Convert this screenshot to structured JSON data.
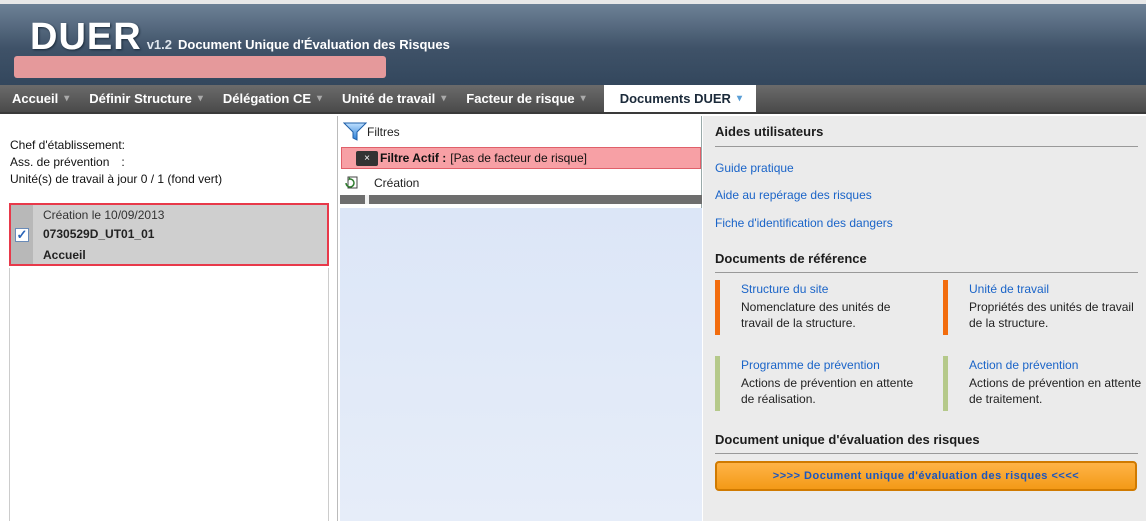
{
  "header": {
    "logo": "DUER",
    "version": "v1.2",
    "subtitle": "Document Unique d'Évaluation des Risques"
  },
  "nav": {
    "items": [
      {
        "label": "Accueil"
      },
      {
        "label": "Définir Structure"
      },
      {
        "label": "Délégation CE"
      },
      {
        "label": "Unité de travail"
      },
      {
        "label": "Facteur de risque"
      },
      {
        "label": "Documents DUER"
      }
    ],
    "caret": "▾"
  },
  "left": {
    "chef_label": "Chef d'établissement:",
    "ass_label": "Ass. de prévention",
    "ass_sep": ":",
    "units_status": "Unité(s) de travail à jour 0 / 1 (fond vert)",
    "card": {
      "created": "Création le 10/09/2013",
      "code": "0730529D_UT01_01",
      "name": "Accueil",
      "checked": true
    }
  },
  "middle": {
    "filters_label": "Filtres",
    "filter_active_label": "Filtre Actif :",
    "filter_active_value": "[Pas de facteur de risque]",
    "close_glyph": "×",
    "creation_label": "Création"
  },
  "right": {
    "aides_title": "Aides utilisateurs",
    "aides_links": [
      "Guide pratique",
      "Aide au repérage des risques",
      "Fiche d'identification des dangers"
    ],
    "refs_title": "Documents de référence",
    "refs": [
      {
        "title": "Structure du site",
        "desc": "Nomenclature des unités de travail de la structure.",
        "color": "#f26c0d"
      },
      {
        "title": "Unité de travail",
        "desc": "Propriétés des unités de travail de la structure.",
        "color": "#f26c0d"
      },
      {
        "title": "Programme de prévention",
        "desc": "Actions de prévention en attente de réalisation.",
        "color": "#b5c98a"
      },
      {
        "title": "Action de prévention",
        "desc": "Actions de prévention en attente de traitement.",
        "color": "#b5c98a"
      }
    ],
    "duer_title": "Document unique d'évaluation des risques",
    "duer_button": ">>>> Document unique d'évaluation des risques <<<<"
  }
}
